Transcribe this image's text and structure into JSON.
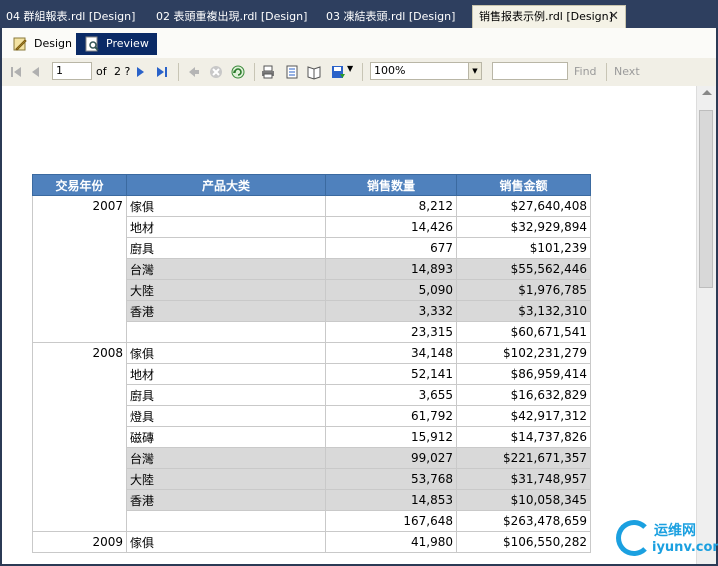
{
  "tabs": [
    {
      "label": "04 群組報表.rdl [Design]"
    },
    {
      "label": "02 表頭重複出現.rdl [Design]"
    },
    {
      "label": "03 凍結表頭.rdl [Design]"
    },
    {
      "label": "销售报表示例.rdl [Design]"
    }
  ],
  "subtabs": {
    "design": "Design",
    "preview": "Preview"
  },
  "toolbar": {
    "page": "1",
    "of_label": "of",
    "total_pages": "2 ?",
    "zoom": "100%",
    "find_value": "",
    "find_label": "Find",
    "next_label": "Next"
  },
  "report": {
    "headers": [
      "交易年份",
      "产品大类",
      "销售数量",
      "销售金额"
    ],
    "groups": [
      {
        "year": "2007",
        "rows": [
          {
            "category": "傢俱",
            "qty": "8,212",
            "amount": "$27,640,408",
            "gray": false
          },
          {
            "category": "地材",
            "qty": "14,426",
            "amount": "$32,929,894",
            "gray": false
          },
          {
            "category": "廚具",
            "qty": "677",
            "amount": "$101,239",
            "gray": false
          },
          {
            "category": "台灣",
            "qty": "14,893",
            "amount": "$55,562,446",
            "gray": true
          },
          {
            "category": "大陸",
            "qty": "5,090",
            "amount": "$1,976,785",
            "gray": true
          },
          {
            "category": "香港",
            "qty": "3,332",
            "amount": "$3,132,310",
            "gray": true
          },
          {
            "category": "",
            "qty": "23,315",
            "amount": "$60,671,541",
            "gray": false
          }
        ]
      },
      {
        "year": "2008",
        "rows": [
          {
            "category": "傢俱",
            "qty": "34,148",
            "amount": "$102,231,279",
            "gray": false
          },
          {
            "category": "地材",
            "qty": "52,141",
            "amount": "$86,959,414",
            "gray": false
          },
          {
            "category": "廚具",
            "qty": "3,655",
            "amount": "$16,632,829",
            "gray": false
          },
          {
            "category": "燈具",
            "qty": "61,792",
            "amount": "$42,917,312",
            "gray": false
          },
          {
            "category": "磁磚",
            "qty": "15,912",
            "amount": "$14,737,826",
            "gray": false
          },
          {
            "category": "台灣",
            "qty": "99,027",
            "amount": "$221,671,357",
            "gray": true
          },
          {
            "category": "大陸",
            "qty": "53,768",
            "amount": "$31,748,957",
            "gray": true
          },
          {
            "category": "香港",
            "qty": "14,853",
            "amount": "$10,058,345",
            "gray": true
          },
          {
            "category": "",
            "qty": "167,648",
            "amount": "$263,478,659",
            "gray": false
          }
        ]
      },
      {
        "year": "2009",
        "rows": [
          {
            "category": "傢俱",
            "qty": "41,980",
            "amount": "$106,550,282",
            "gray": false
          }
        ]
      }
    ]
  },
  "watermark": {
    "line1": "运维网",
    "line2": "iyunv.com"
  }
}
